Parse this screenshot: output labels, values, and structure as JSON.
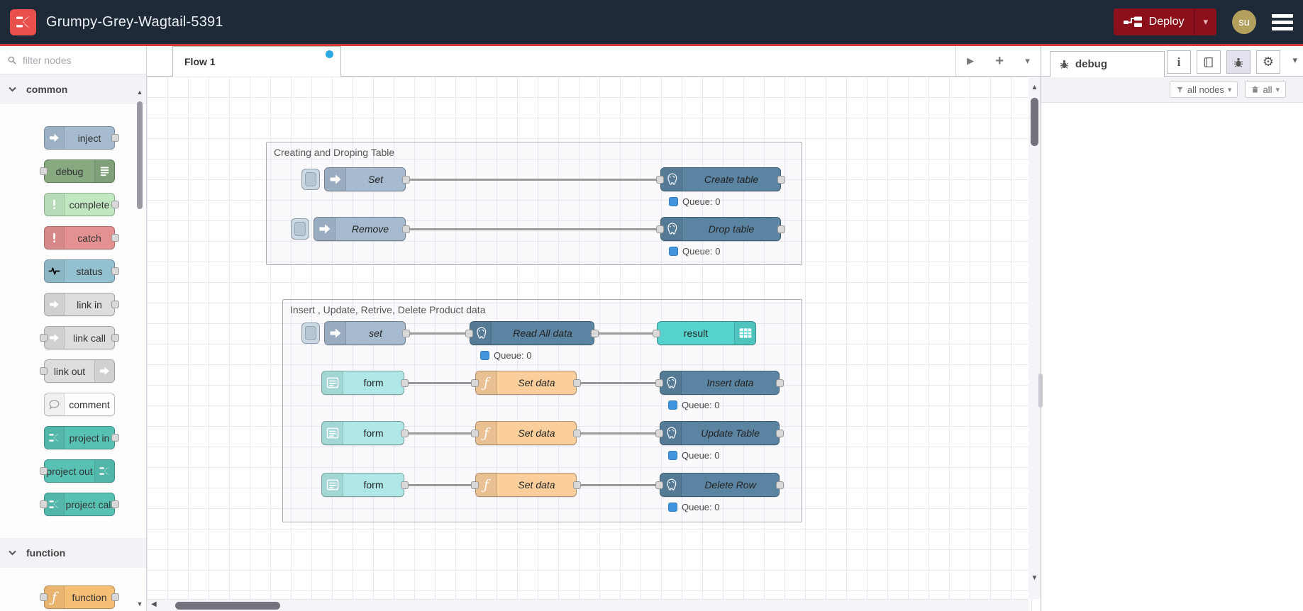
{
  "header": {
    "title": "Grumpy-Grey-Wagtail-5391",
    "deploy": "Deploy",
    "avatar": "su"
  },
  "palette": {
    "search_placeholder": "filter nodes",
    "categories": [
      {
        "label": "common",
        "items": [
          {
            "label": "inject"
          },
          {
            "label": "debug"
          },
          {
            "label": "complete"
          },
          {
            "label": "catch"
          },
          {
            "label": "status"
          },
          {
            "label": "link in"
          },
          {
            "label": "link call"
          },
          {
            "label": "link out"
          },
          {
            "label": "comment"
          },
          {
            "label": "project in"
          },
          {
            "label": "project out"
          },
          {
            "label": "project call"
          }
        ]
      },
      {
        "label": "function",
        "items": [
          {
            "label": "function"
          }
        ]
      }
    ]
  },
  "flow": {
    "tab": "Flow 1",
    "groups": [
      {
        "title": "Creating and Droping Table",
        "nodes": [
          {
            "label": "Set"
          },
          {
            "label": "Create table",
            "status": "Queue: 0"
          },
          {
            "label": "Remove"
          },
          {
            "label": "Drop table",
            "status": "Queue: 0"
          }
        ]
      },
      {
        "title": "Insert , Update, Retrive, Delete Product data",
        "nodes": [
          {
            "label": "set"
          },
          {
            "label": "Read All data",
            "status": "Queue: 0"
          },
          {
            "label": "result"
          },
          {
            "label": "form"
          },
          {
            "label": "Set data"
          },
          {
            "label": "Insert data",
            "status": "Queue: 0"
          },
          {
            "label": "form"
          },
          {
            "label": "Set data"
          },
          {
            "label": "Update Table",
            "status": "Queue: 0"
          },
          {
            "label": "form"
          },
          {
            "label": "Set data"
          },
          {
            "label": "Delete Row",
            "status": "Queue: 0"
          }
        ]
      }
    ]
  },
  "sidebar": {
    "tab": "debug",
    "filter_button": "all nodes",
    "clear_button": "all"
  },
  "colors": {
    "header_bg": "#1e2a38",
    "accent_red": "#d63b33",
    "deploy_bg": "#8c101c",
    "logo_red": "#e8504c",
    "avatar_bg": "#b3a05c",
    "tab_dot": "#29a8e2",
    "node_inject": "#a6bbcf",
    "node_debug": "#87a980",
    "node_complete": "#c2e8c2",
    "node_catch": "#e49191",
    "node_status": "#94c1d0",
    "node_link": "#dddddd",
    "node_comment": "#fefefe",
    "node_project": "#57c2b4",
    "node_function": "#fbcf9c",
    "node_postgres": "#5b84a2",
    "node_form": "#afe8e6",
    "node_result": "#55d2cc",
    "queue_dot": "#4296db"
  }
}
